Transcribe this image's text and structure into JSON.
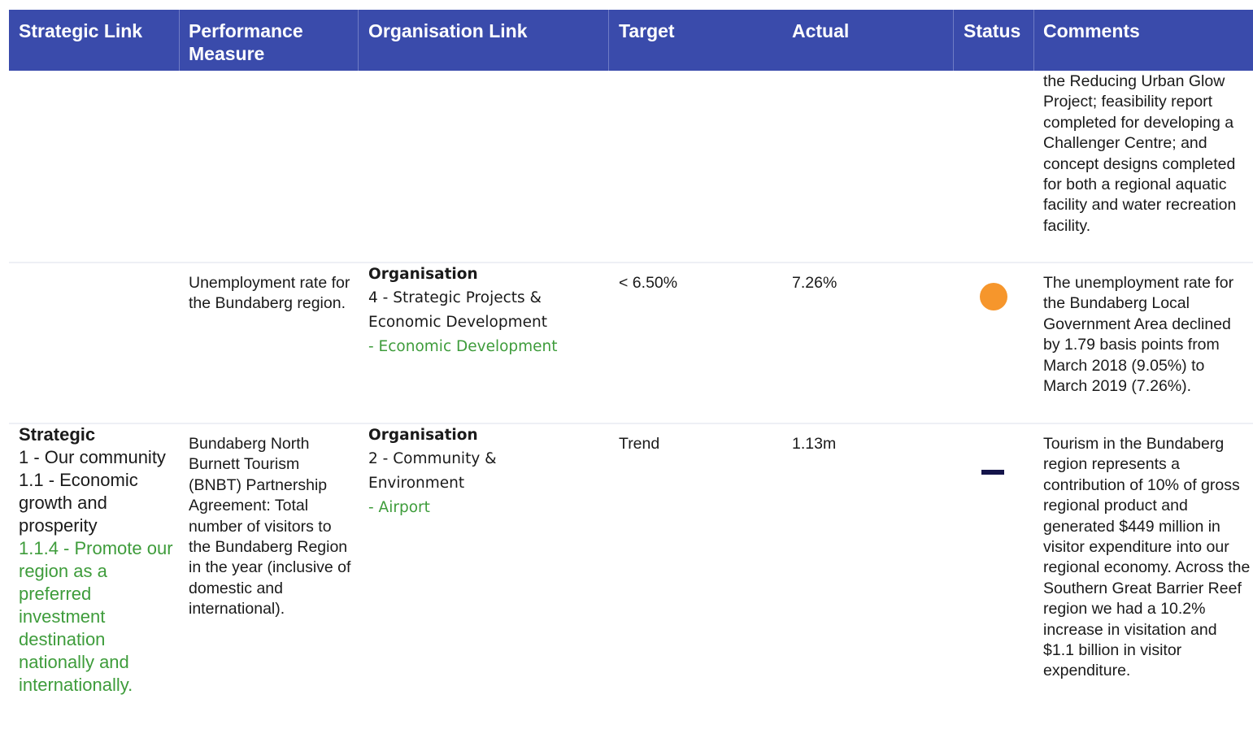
{
  "header": {
    "strategic_link": "Strategic Link",
    "performance_measure": "Performance Measure",
    "organisation_link": "Organisation Link",
    "target": "Target",
    "actual": "Actual",
    "status": "Status",
    "comments": "Comments"
  },
  "rows": [
    {
      "comments": "the Reducing Urban Glow Project; feasibility report completed for developing a Challenger Centre; and concept designs completed for both a regional aquatic facility and water recreation facility."
    },
    {
      "performance_measure": "Unemployment rate for the Bundaberg region.",
      "org_title": "Organisation",
      "org_line1": "4 - Strategic Projects & Economic Development",
      "org_line2": "- Economic Development",
      "target": "< 6.50%",
      "actual": "7.26%",
      "status": "amber-circle",
      "status_color": "#f6962c",
      "comments": "The unemployment rate for the Bundaberg Local Government Area declined by 1.79 basis points from March 2018 (9.05%) to March 2019 (7.26%)."
    },
    {
      "strategic_title": "Strategic",
      "strategic_line1": "1 - Our community",
      "strategic_line2": "1.1 - Economic growth and prosperity",
      "strategic_line3": "1.1.4 - Promote our region as a preferred investment destination nationally and internationally.",
      "performance_measure": "Bundaberg North Burnett Tourism (BNBT) Partnership Agreement: Total number of visitors to the Bundaberg Region in the year (inclusive of domestic and international).",
      "org_title": "Organisation",
      "org_line1": "2 - Community & Environment",
      "org_line2": "- Airport",
      "target": "Trend",
      "actual": "1.13m",
      "status": "dash",
      "status_color": "#14144a",
      "comments": "Tourism in the Bundaberg region represents a contribution of 10% of gross regional product and generated $449 million in visitor expenditure into our regional economy. Across the Southern Great Barrier Reef region we had a 10.2% increase in visitation and $1.1 billion in visitor expenditure."
    }
  ],
  "colors": {
    "header_bg": "#3a4bab",
    "green_text": "#3e9c3b",
    "amber": "#f6962c"
  }
}
